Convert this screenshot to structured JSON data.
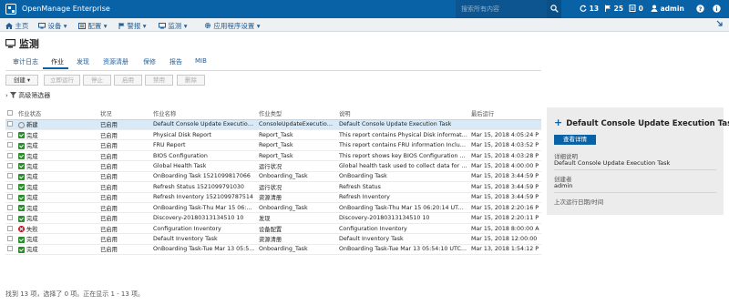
{
  "app": {
    "title": "OpenManage Enterprise",
    "search_placeholder": "搜索所有内容"
  },
  "topstats": {
    "jobs": "13",
    "alerts": "25",
    "warranty": "0",
    "user": "admin"
  },
  "menu": [
    "主页",
    "设备",
    "配置",
    "警报",
    "监测",
    "应用程序设置"
  ],
  "page_title": "监测",
  "tabs": [
    "审计日志",
    "作业",
    "发现",
    "资源清册",
    "保修",
    "报告",
    "MIB"
  ],
  "toolbar": [
    "创建",
    "立即运行",
    "停止",
    "启用",
    "禁用",
    "删除"
  ],
  "advanced_filter": "高级筛选器",
  "table": {
    "headers": [
      "作业状态",
      "状况",
      "作业名称",
      "作业类型",
      "说明",
      "最后运行"
    ],
    "rows": [
      {
        "status": "新建",
        "state": "已启用",
        "name": "Default Console Update Execution ...",
        "type": "ConsoleUpdateExecution...",
        "desc": "Default Console Update Execution Task",
        "last": ""
      },
      {
        "status": "完成",
        "state": "已启用",
        "name": "Physical Disk Report",
        "type": "Report_Task",
        "desc": "This report contains Physical Disk informati...",
        "last": "Mar 15, 2018 4:05:24 P"
      },
      {
        "status": "完成",
        "state": "已启用",
        "name": "FRU Report",
        "type": "Report_Task",
        "desc": "This report contains FRU information Includi...",
        "last": "Mar 15, 2018 4:03:52 P"
      },
      {
        "status": "完成",
        "state": "已启用",
        "name": "BIOS Configuration",
        "type": "Report_Task",
        "desc": "This report shows key BIOS Configuration par...",
        "last": "Mar 15, 2018 4:03:28 P"
      },
      {
        "status": "完成",
        "state": "已启用",
        "name": "Global Health Task",
        "type": "运行状况",
        "desc": "Global health task used to collect data for he...",
        "last": "Mar 15, 2018 4:00:00 P"
      },
      {
        "status": "完成",
        "state": "已启用",
        "name": "OnBoarding Task 1521099817066",
        "type": "Onboarding_Task",
        "desc": "OnBoarding Task",
        "last": "Mar 15, 2018 3:44:59 P"
      },
      {
        "status": "完成",
        "state": "已启用",
        "name": "Refresh Status 1521099791030",
        "type": "运行状况",
        "desc": "Refresh Status",
        "last": "Mar 15, 2018 3:44:59 P"
      },
      {
        "status": "完成",
        "state": "已启用",
        "name": "Refresh Inventory 1521099787514",
        "type": "资源清册",
        "desc": "Refresh Inventory",
        "last": "Mar 15, 2018 3:44:59 P"
      },
      {
        "status": "完成",
        "state": "已启用",
        "name": "OnBoarding Task-Thu Mar 15 06:2...",
        "type": "Onboarding_Task",
        "desc": "OnBoarding Task-Thu Mar 15 06:20:14 UTC ...",
        "last": "Mar 15, 2018 2:20:16 P"
      },
      {
        "status": "完成",
        "state": "已启用",
        "name": "Discovery-20180313134510 10",
        "type": "发现",
        "desc": "Discovery-20180313134510 10",
        "last": "Mar 15, 2018 2:20:11 P"
      },
      {
        "status": "失败",
        "state": "已启用",
        "name": "Configuration Inventory",
        "type": "设备配置",
        "desc": "Configuration Inventory",
        "last": "Mar 15, 2018 8:00:00 A"
      },
      {
        "status": "完成",
        "state": "已启用",
        "name": "Default Inventory Task",
        "type": "资源清册",
        "desc": "Default Inventory Task",
        "last": "Mar 15, 2018 12:00:00"
      },
      {
        "status": "完成",
        "state": "已启用",
        "name": "OnBoarding Task-Tue Mar 13 05:5...",
        "type": "Onboarding_Task",
        "desc": "OnBoarding Task-Tue Mar 13 05:54:10 UTC ...",
        "last": "Mar 13, 2018 1:54:12 P"
      }
    ]
  },
  "footer": "找到 13 项，选择了 0 项。正在显示 1 - 13 项。",
  "panel": {
    "title": "Default Console Update Execution Task",
    "button": "查看详情",
    "desc_label": "详细说明",
    "desc_value": "Default Console Update Execution Task",
    "creator_label": "创建者",
    "creator_value": "admin",
    "lastrun_label": "上次运行日期/时间"
  }
}
